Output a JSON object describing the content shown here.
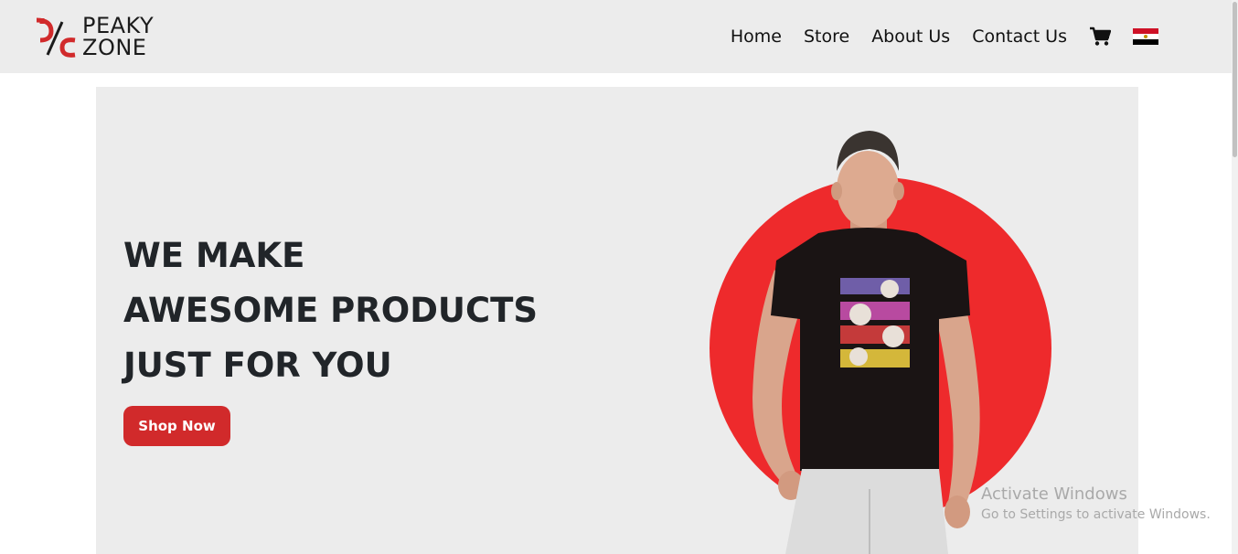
{
  "brand": {
    "line1": "PEAKY",
    "line2": "ZONE",
    "mark_color": "#d12a2b"
  },
  "nav": {
    "items": [
      "Home",
      "Store",
      "About Us",
      "Contact Us"
    ],
    "icons": [
      "cart-icon",
      "egypt-flag-icon"
    ]
  },
  "hero": {
    "headline": [
      "WE MAKE",
      "AWESOME PRODUCTS",
      "JUST FOR YOU"
    ],
    "cta_label": "Shop Now",
    "accent_color": "#ee2a2c",
    "bg_color": "#ececec"
  },
  "watermark": {
    "title": "Activate Windows",
    "subtitle": "Go to Settings to activate Windows."
  }
}
